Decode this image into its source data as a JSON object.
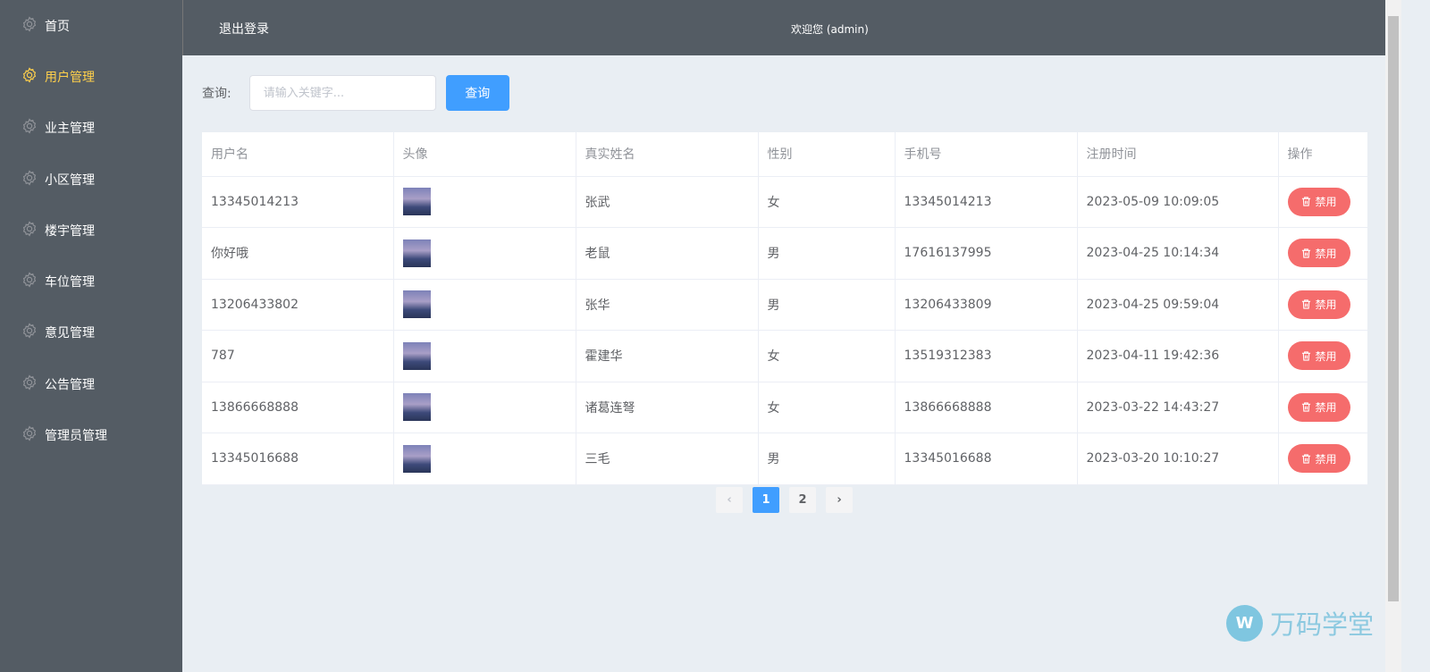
{
  "sidebar": {
    "items": [
      {
        "label": "首页",
        "active": false
      },
      {
        "label": "用户管理",
        "active": true
      },
      {
        "label": "业主管理",
        "active": false
      },
      {
        "label": "小区管理",
        "active": false
      },
      {
        "label": "楼宇管理",
        "active": false
      },
      {
        "label": "车位管理",
        "active": false
      },
      {
        "label": "意见管理",
        "active": false
      },
      {
        "label": "公告管理",
        "active": false
      },
      {
        "label": "管理员管理",
        "active": false
      }
    ]
  },
  "header": {
    "logout": "退出登录",
    "welcome": "欢迎您 (admin)"
  },
  "search": {
    "label": "查询:",
    "placeholder": "请输入关键字...",
    "button": "查询"
  },
  "table": {
    "columns": [
      "用户名",
      "头像",
      "真实姓名",
      "性别",
      "手机号",
      "注册时间",
      "操作"
    ],
    "rows": [
      {
        "username": "13345014213",
        "name": "张武",
        "gender": "女",
        "phone": "13345014213",
        "time": "2023-05-09 10:09:05",
        "action": "禁用"
      },
      {
        "username": "你好哦",
        "name": "老鼠",
        "gender": "男",
        "phone": "17616137995",
        "time": "2023-04-25 10:14:34",
        "action": "禁用"
      },
      {
        "username": "13206433802",
        "name": "张华",
        "gender": "男",
        "phone": "13206433809",
        "time": "2023-04-25 09:59:04",
        "action": "禁用"
      },
      {
        "username": "787",
        "name": "霍建华",
        "gender": "女",
        "phone": "13519312383",
        "time": "2023-04-11 19:42:36",
        "action": "禁用"
      },
      {
        "username": "13866668888",
        "name": "诸葛连弩",
        "gender": "女",
        "phone": "13866668888",
        "time": "2023-03-22 14:43:27",
        "action": "禁用"
      },
      {
        "username": "13345016688",
        "name": "三毛",
        "gender": "男",
        "phone": "13345016688",
        "time": "2023-03-20 10:10:27",
        "action": "禁用"
      }
    ]
  },
  "pagination": {
    "prev": "‹",
    "pages": [
      "1",
      "2"
    ],
    "current": "1",
    "next": "›"
  },
  "watermark": {
    "logo": "W",
    "text": "万码学堂"
  },
  "colors": {
    "sidebar": "#545c64",
    "active": "#ffd04b",
    "primary": "#409eff",
    "danger": "#f56c6c"
  }
}
